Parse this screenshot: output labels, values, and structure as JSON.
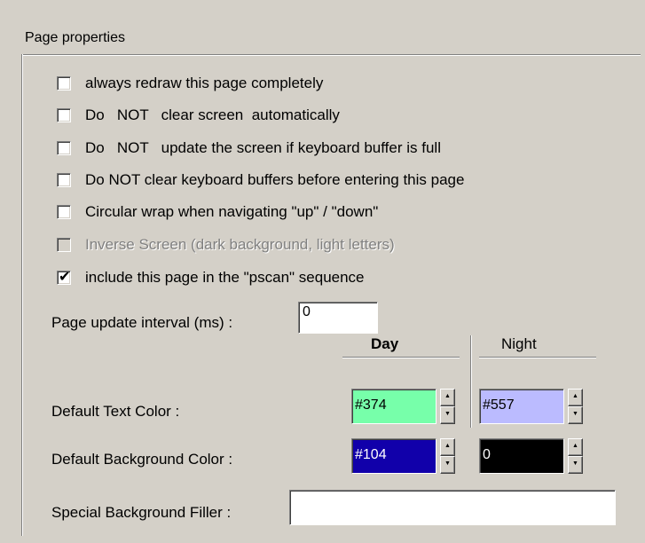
{
  "group_title": "Page properties",
  "checkboxes": [
    {
      "label": "always redraw this page completely",
      "checked": false,
      "enabled": true
    },
    {
      "label": "Do   NOT   clear screen  automatically",
      "checked": false,
      "enabled": true
    },
    {
      "label": "Do   NOT   update the screen if keyboard buffer is full",
      "checked": false,
      "enabled": true
    },
    {
      "label": "Do NOT clear keyboard buffers before entering this page",
      "checked": false,
      "enabled": true
    },
    {
      "label": "Circular wrap when navigating \"up\" / \"down\"",
      "checked": false,
      "enabled": true
    },
    {
      "label": "Inverse Screen (dark background, light letters)",
      "checked": false,
      "enabled": false
    },
    {
      "label": "include this page in the \"pscan\" sequence",
      "checked": true,
      "enabled": true
    }
  ],
  "update_interval": {
    "label": "Page update interval (ms) :",
    "value": "0"
  },
  "columns": {
    "day": "Day",
    "night": "Night"
  },
  "text_color": {
    "label": "Default Text Color :",
    "day": {
      "value": "#374",
      "bg": "#77ffaa",
      "fg": "#000000"
    },
    "night": {
      "value": "#557",
      "bg": "#bbbbff",
      "fg": "#000000"
    }
  },
  "background_color": {
    "label": "Default Background Color :",
    "day": {
      "value": "#104",
      "bg": "#1100aa",
      "fg": "#ffffff"
    },
    "night": {
      "value": "0",
      "bg": "#000000",
      "fg": "#ffffff"
    }
  },
  "special_filler": {
    "label": "Special Background Filler :",
    "value": ""
  },
  "icons": {
    "check": "✔",
    "spin_up": "▲",
    "spin_down": "▼"
  }
}
